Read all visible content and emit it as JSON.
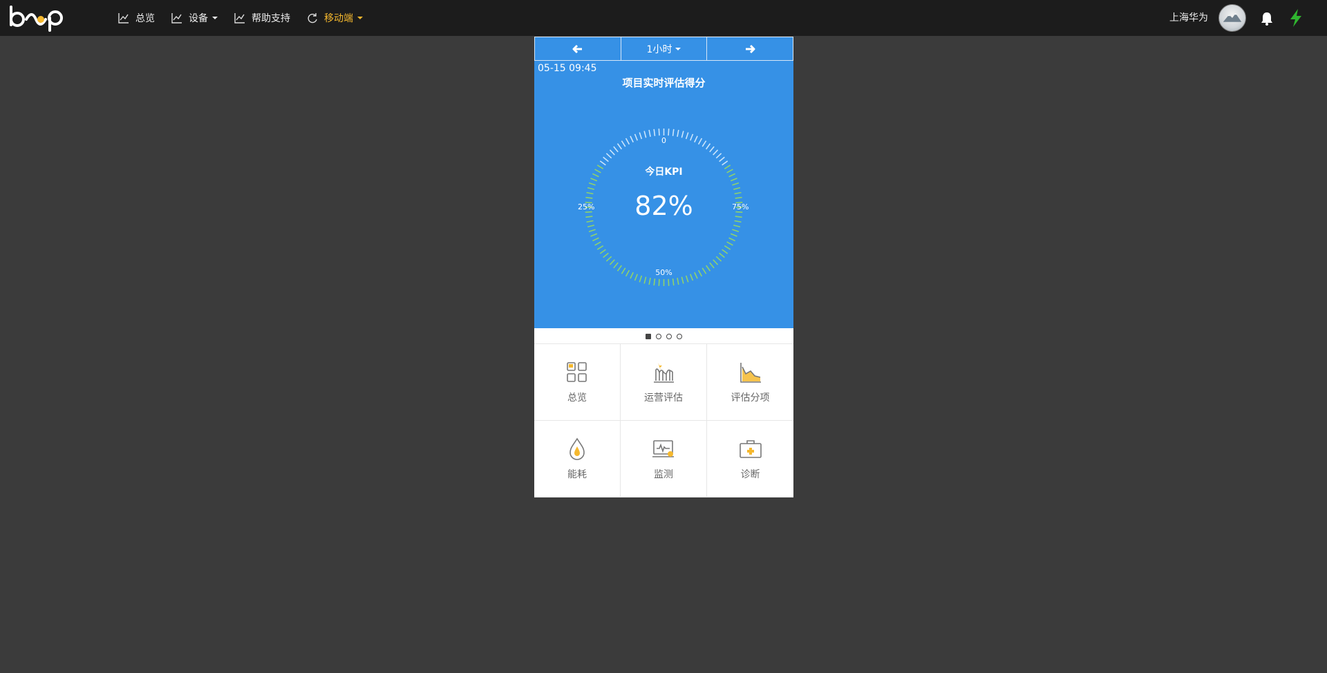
{
  "topbar": {
    "logo_text": "beep",
    "nav": [
      {
        "label": "总览",
        "icon": "line-chart-icon"
      },
      {
        "label": "设备",
        "icon": "line-chart-icon",
        "dropdown": true
      },
      {
        "label": "帮助支持",
        "icon": "line-chart-icon"
      },
      {
        "label": "移动端",
        "icon": "refresh-icon",
        "dropdown": true,
        "active": true
      }
    ],
    "user_name": "上海华为",
    "icons": [
      "avatar",
      "bell-icon",
      "bolt-icon"
    ]
  },
  "phone": {
    "toolbar": {
      "prev_icon": "arrow-left-icon",
      "period_label": "1小时",
      "next_icon": "arrow-right-icon"
    },
    "gauge": {
      "datetime": "05-15 09:45",
      "title": "项目实时评估得分",
      "label_top": "0",
      "label_left": "25%",
      "label_right": "75%",
      "label_bottom": "50%",
      "kpi_label": "今日KPI",
      "kpi_value": "82%",
      "kpi_fraction": 0.82
    },
    "pager": {
      "count": 4,
      "active": 0
    },
    "menu": [
      {
        "label": "总览",
        "icon": "overview-grid-icon"
      },
      {
        "label": "运营评估",
        "icon": "bar-chart-icon"
      },
      {
        "label": "评估分项",
        "icon": "area-chart-icon"
      },
      {
        "label": "能耗",
        "icon": "water-drop-icon"
      },
      {
        "label": "监测",
        "icon": "monitor-icon"
      },
      {
        "label": "诊断",
        "icon": "medical-kit-icon"
      }
    ]
  },
  "colors": {
    "topbar_bg": "#1c1c1c",
    "page_bg": "#3b3b3b",
    "panel_blue": "#3691e6",
    "tick_green": "#8fd36b",
    "accent_yellow": "#f5b82e",
    "bolt_green": "#2fb52f"
  }
}
